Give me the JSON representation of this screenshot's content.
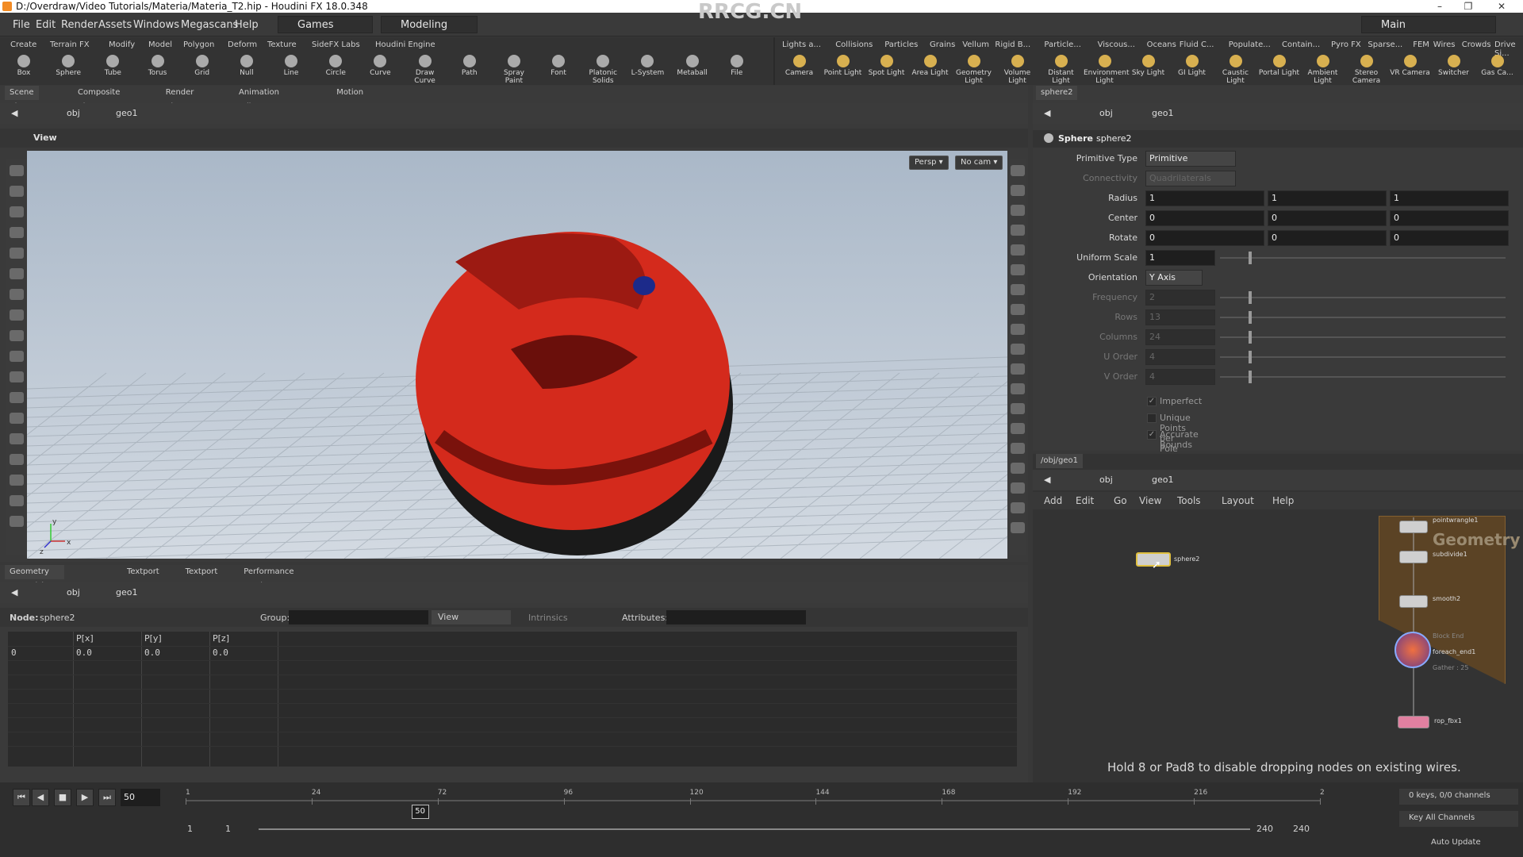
{
  "window": {
    "title": "D:/Overdraw/Video Tutorials/Materia/Materia_T2.hip - Houdini FX 18.0.348",
    "watermark": "RRCG.CN"
  },
  "menubar": {
    "items": [
      "File",
      "Edit",
      "Render",
      "Assets",
      "Windows",
      "Megascans",
      "Help"
    ],
    "desktop": "Games",
    "mode": "Modeling",
    "main": "Main"
  },
  "shelf": {
    "tabs_left": [
      "Create",
      "Terrain FX",
      "Modify",
      "Model",
      "Polygon",
      "Deform",
      "Texture",
      "SideFX Labs",
      "Houdini Engine"
    ],
    "tools_left": [
      "Box",
      "Sphere",
      "Tube",
      "Torus",
      "Grid",
      "Null",
      "Line",
      "Circle",
      "Curve",
      "Draw Curve",
      "Path",
      "Spray Paint",
      "Font",
      "Platonic Solids",
      "L-System",
      "Metaball",
      "File"
    ],
    "tabs_right": [
      "Lights a...",
      "Collisions",
      "Particles",
      "Grains",
      "Vellum",
      "Rigid B...",
      "Particle...",
      "Viscous...",
      "Oceans",
      "Fluid C...",
      "Populate...",
      "Contain...",
      "Pyro FX",
      "Sparse...",
      "FEM",
      "Wires",
      "Crowds",
      "Drive Si..."
    ],
    "tools_right": [
      "Camera",
      "Point Light",
      "Spot Light",
      "Area Light",
      "Geometry Light",
      "Volume Light",
      "Distant Light",
      "Environment Light",
      "Sky Light",
      "GI Light",
      "Caustic Light",
      "Portal Light",
      "Ambient Light",
      "Stereo Camera",
      "VR Camera",
      "Switcher",
      "Gas Ca..."
    ]
  },
  "viewer": {
    "tabs": [
      "Scene View",
      "Composite View",
      "Render View",
      "Animation Editor",
      "Motion FX View"
    ],
    "path": [
      "obj",
      "geo1"
    ],
    "header": "View",
    "persp": "Persp",
    "cam": "No cam",
    "axis_y": "y",
    "axis_x": "x",
    "axis_z": "z"
  },
  "params": {
    "tab": "sphere2",
    "path": [
      "obj",
      "geo1"
    ],
    "node_type": "Sphere",
    "node_name": "sphere2",
    "rows": [
      {
        "label": "Primitive Type",
        "value": "Primitive",
        "kind": "menu"
      },
      {
        "label": "Connectivity",
        "value": "Quadrilaterals",
        "kind": "menu-disabled"
      },
      {
        "label": "Radius",
        "values": [
          "1",
          "1",
          "1"
        ]
      },
      {
        "label": "Center",
        "values": [
          "0",
          "0",
          "0"
        ]
      },
      {
        "label": "Rotate",
        "values": [
          "0",
          "0",
          "0"
        ]
      },
      {
        "label": "Uniform Scale",
        "values": [
          "1"
        ]
      },
      {
        "label": "Orientation",
        "value": "Y Axis",
        "kind": "menu"
      },
      {
        "label": "Frequency",
        "values": [
          "2"
        ],
        "disabled": true
      },
      {
        "label": "Rows",
        "values": [
          "13"
        ],
        "disabled": true
      },
      {
        "label": "Columns",
        "values": [
          "24"
        ],
        "disabled": true
      },
      {
        "label": "U Order",
        "values": [
          "4"
        ],
        "disabled": true
      },
      {
        "label": "V Order",
        "values": [
          "4"
        ],
        "disabled": true
      }
    ],
    "checks": [
      {
        "label": "Imperfect",
        "checked": true
      },
      {
        "label": "Unique Points per Pole",
        "checked": false
      },
      {
        "label": "Accurate Bounds",
        "checked": true
      }
    ],
    "uniform_scale_fraction": 0.1
  },
  "network": {
    "tab": "/obj/geo1",
    "path": [
      "obj",
      "geo1"
    ],
    "menu": [
      "Add",
      "Edit",
      "Go",
      "View",
      "Tools",
      "Layout",
      "Help"
    ],
    "title": "Geometry",
    "nodes": [
      {
        "name": "pointwrangle1"
      },
      {
        "name": "subdivide1"
      },
      {
        "name": "smooth2"
      },
      {
        "name": "foreach_end1",
        "sub": "Gather : 25",
        "pre": "Block End"
      },
      {
        "name": "rop_fbx1"
      },
      {
        "name": "sphere2"
      }
    ],
    "hint": "Hold 8 or Pad8 to disable dropping nodes on existing wires."
  },
  "spreadsheet": {
    "tabs": [
      "Geometry Spreadsheet",
      "Textport",
      "Textport",
      "Performance Monitor"
    ],
    "path": [
      "obj",
      "geo1"
    ],
    "node_label": "Node:",
    "node": "sphere2",
    "group_label": "Group:",
    "view": "View",
    "intrinsics": "Intrinsics",
    "attributes_label": "Attributes:",
    "columns": [
      "",
      "P[x]",
      "P[y]",
      "P[z]"
    ],
    "rows": [
      [
        "0",
        "0.0",
        "0.0",
        "0.0"
      ]
    ]
  },
  "timeline": {
    "frame": "50",
    "ticks": [
      "1",
      "24",
      "72",
      "96",
      "120",
      "144",
      "168",
      "192",
      "216",
      "2"
    ],
    "current_marker": "50",
    "range_start": "1",
    "range_start2": "1",
    "range_end": "240",
    "range_end2": "240",
    "keys": "0 keys, 0/0 channels",
    "key_all": "Key All Channels",
    "auto_update": "Auto Update",
    "playhead_fraction": 0.206
  },
  "colors": {
    "sphere": "#d42a1c",
    "accent": "#f0a030",
    "node_selected": "#e0c040"
  }
}
